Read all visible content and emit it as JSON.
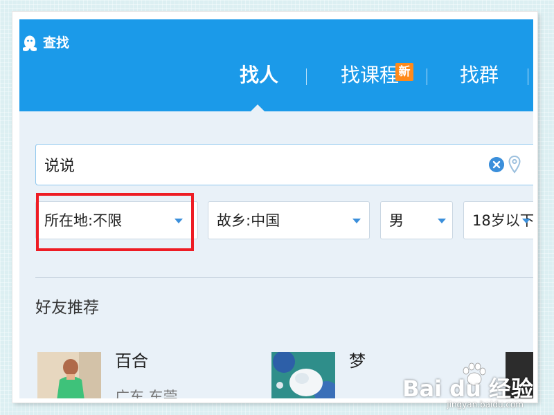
{
  "app": {
    "title": "查找"
  },
  "tabs": [
    {
      "label": "找人",
      "active": true
    },
    {
      "label": "找课程",
      "badge": "新"
    },
    {
      "label": "找群"
    }
  ],
  "search": {
    "value": "说说",
    "icons": [
      "clear-icon",
      "location-pin-icon"
    ]
  },
  "filters": [
    {
      "label": "所在地:不限"
    },
    {
      "label": "故乡:中国"
    },
    {
      "label": "男"
    },
    {
      "label": "18岁以下"
    }
  ],
  "section": {
    "title": "好友推荐"
  },
  "friends": [
    {
      "name": "百合",
      "location": "广东 东莞"
    },
    {
      "name": "梦"
    }
  ],
  "watermark": {
    "text": "Bai du 经验",
    "sub": "jingyan.baidu.com"
  },
  "colors": {
    "header": "#1b9ae9",
    "badge": "#ff8a1a",
    "highlight": "#ee1c24",
    "accent": "#3b8fdb"
  }
}
